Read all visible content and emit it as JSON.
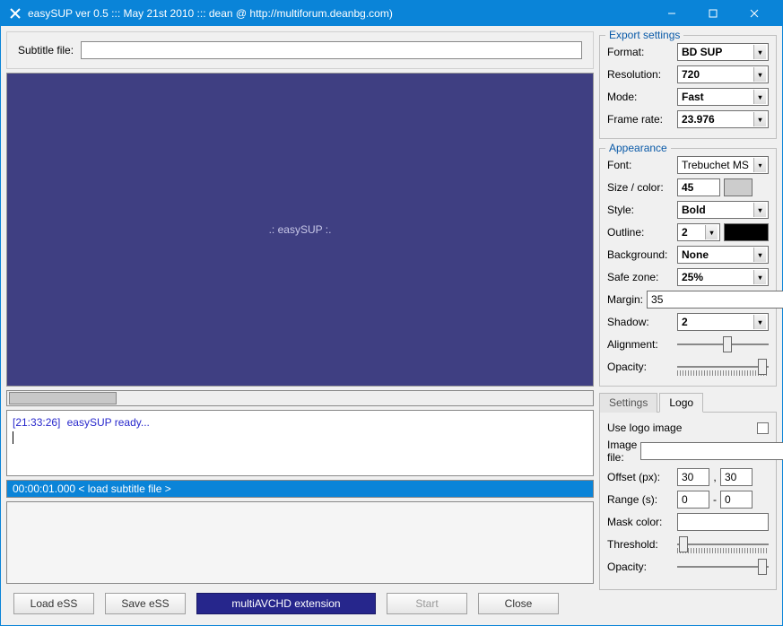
{
  "titlebar": {
    "title": "easySUP ver 0.5 ::: May 21st 2010 ::: dean @ http://multiforum.deanbg.com)"
  },
  "subtitle": {
    "label": "Subtitle file:",
    "value": ""
  },
  "preview": {
    "center_text": ".: easySUP :."
  },
  "log": {
    "timestamp": "[21:33:26]",
    "message": "easySUP ready..."
  },
  "status": {
    "text": "00:00:01.000 < load subtitle file >"
  },
  "buttons": {
    "load": "Load eSS",
    "save": "Save eSS",
    "ext": "multiAVCHD extension",
    "start": "Start",
    "close": "Close"
  },
  "export": {
    "title": "Export settings",
    "format_label": "Format:",
    "format_value": "BD SUP",
    "resolution_label": "Resolution:",
    "resolution_value": "720",
    "mode_label": "Mode:",
    "mode_value": "Fast",
    "framerate_label": "Frame rate:",
    "framerate_value": "23.976"
  },
  "appearance": {
    "title": "Appearance",
    "font_label": "Font:",
    "font_value": "Trebuchet MS",
    "size_label": "Size / color:",
    "size_value": "45",
    "style_label": "Style:",
    "style_value": "Bold",
    "outline_label": "Outline:",
    "outline_value": "2",
    "background_label": "Background:",
    "background_value": "None",
    "safezone_label": "Safe zone:",
    "safezone_value": "25%",
    "margin_label": "Margin:",
    "margin_value": "35",
    "shadow_label": "Shadow:",
    "shadow_value": "2",
    "alignment_label": "Alignment:",
    "opacity_label": "Opacity:"
  },
  "tabs": {
    "settings": "Settings",
    "logo": "Logo"
  },
  "logo": {
    "use_label": "Use logo image",
    "imagefile_label": "Image file:",
    "imagefile_value": "",
    "offset_label": "Offset (px):",
    "offset_x": "30",
    "offset_comma": ",",
    "offset_y": "30",
    "range_label": "Range (s):",
    "range_from": "0",
    "range_dash": "-",
    "range_to": "0",
    "mask_label": "Mask color:",
    "threshold_label": "Threshold:",
    "opacity_label": "Opacity:"
  }
}
